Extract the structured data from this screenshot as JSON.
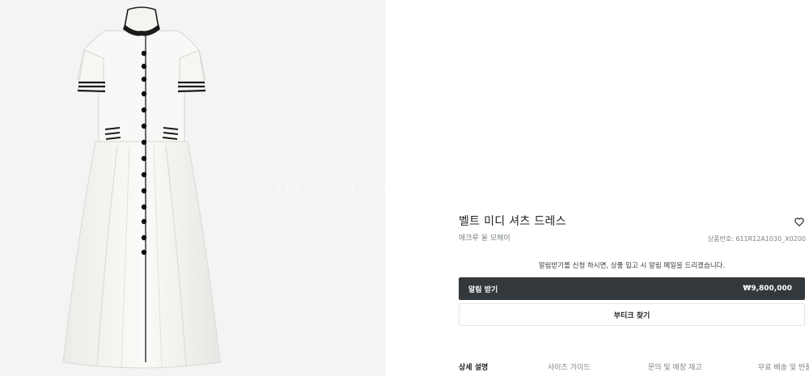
{
  "watermark": {
    "text": "rixx"
  },
  "product": {
    "title": "벨트 미디 셔츠 드레스",
    "subtitle": "에크루 울 모헤어",
    "code": "상품번호: 611R12A1030_X0200",
    "wishlist_icon": "heart-outline-icon"
  },
  "notify": {
    "text": "알림받기를 신청 하시면, 상품 입고 시 알림 메일을 드리겠습니다.",
    "button_label": "알림 받기",
    "price": "₩9,800,000"
  },
  "boutique": {
    "label": "부티크 찾기"
  },
  "tabs": [
    {
      "label": "상세 설명"
    },
    {
      "label": "사이즈 가이드"
    },
    {
      "label": "문의 및 매장 재고"
    },
    {
      "label": "무료 배송 및 반품"
    }
  ],
  "colors": {
    "image_background": "#f4f4f4",
    "dress": "#f7f6f3",
    "trim": "#1a1a1a",
    "button_dark": "#33383c",
    "muted_text": "#7b8487"
  }
}
